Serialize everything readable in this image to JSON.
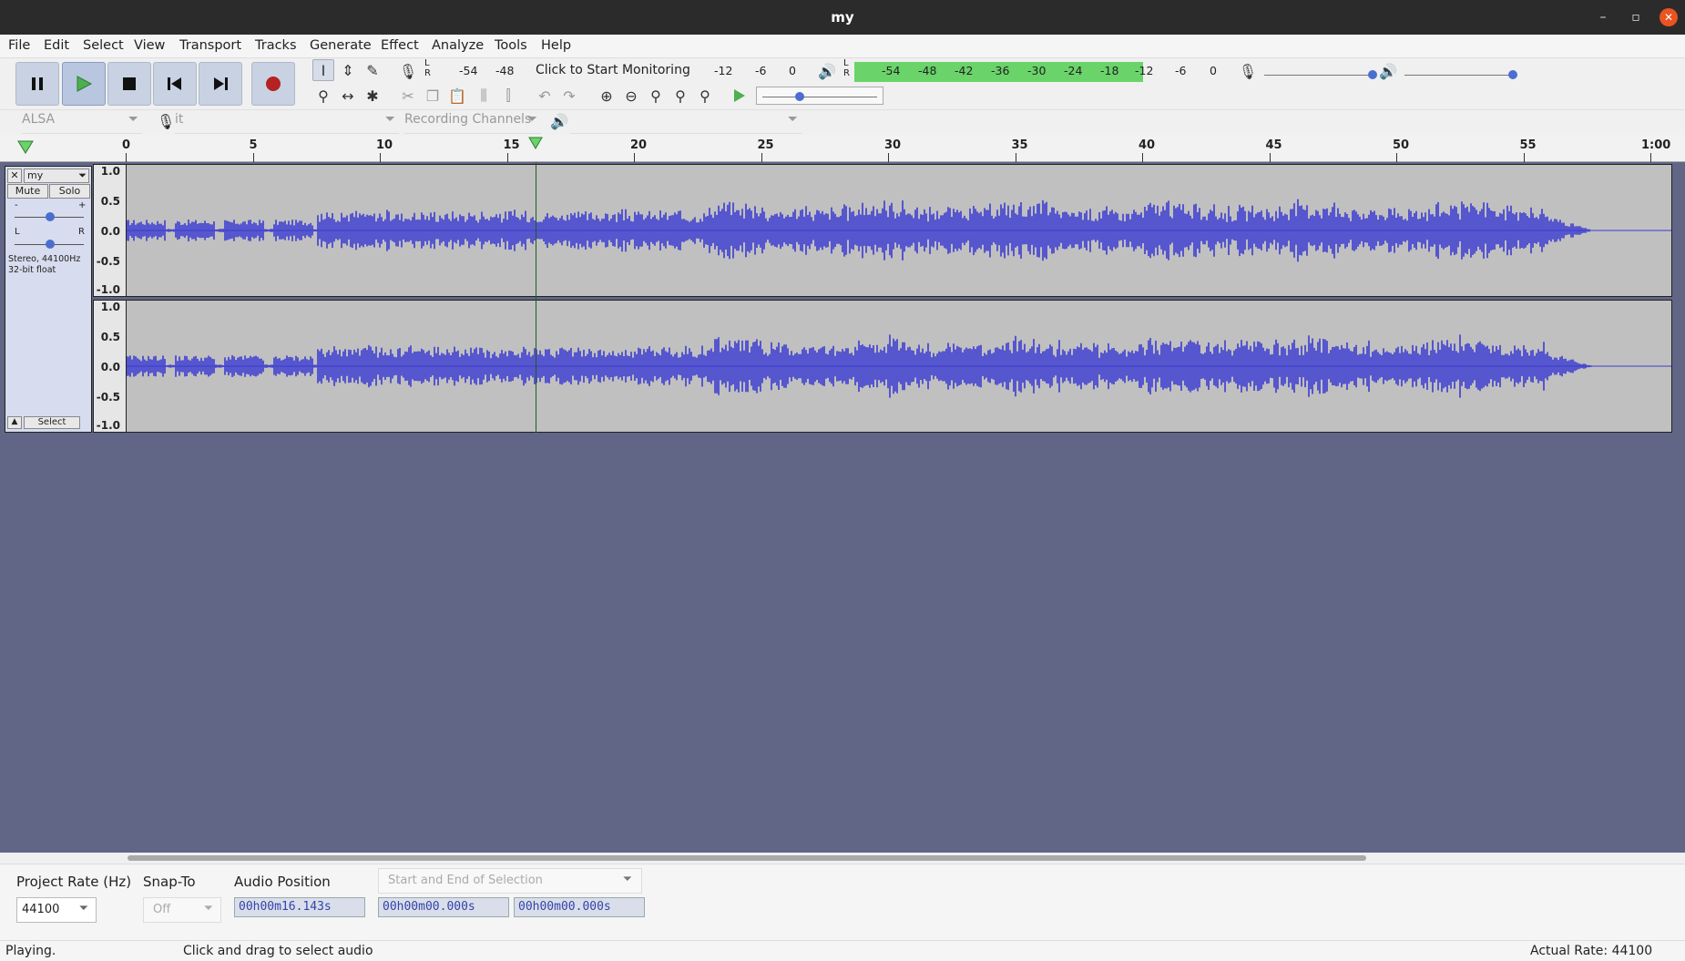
{
  "window": {
    "title": "my"
  },
  "menu": [
    "File",
    "Edit",
    "Select",
    "View",
    "Transport",
    "Tracks",
    "Generate",
    "Effect",
    "Analyze",
    "Tools",
    "Help"
  ],
  "recording_meter": {
    "scale": [
      "-54",
      "-48",
      "-12",
      "-6",
      "0"
    ],
    "prompt": "Click to Start Monitoring"
  },
  "playback_meter": {
    "scale": [
      "-54",
      "-48",
      "-42",
      "-36",
      "-30",
      "-24",
      "-18",
      "-12",
      "-6",
      "0"
    ],
    "level_db": -12
  },
  "device": {
    "host": "ALSA",
    "recording_device": "it",
    "channels": "Recording Channels"
  },
  "ruler": {
    "ticks": [
      "0",
      "5",
      "10",
      "15",
      "20",
      "25",
      "30",
      "35",
      "40",
      "45",
      "50",
      "55",
      "1:00"
    ],
    "playhead_seconds": 16.143
  },
  "track": {
    "name": "my",
    "mute": "Mute",
    "solo": "Solo",
    "gain_minus": "-",
    "gain_plus": "+",
    "pan_left": "L",
    "pan_right": "R",
    "info_line1": "Stereo, 44100Hz",
    "info_line2": "32-bit float",
    "select": "Select",
    "scale": [
      "1.0",
      "0.5",
      "0.0",
      "-0.5",
      "-1.0"
    ]
  },
  "bottom": {
    "project_rate_label": "Project Rate (Hz)",
    "project_rate_value": "44100",
    "snap_label": "Snap-To",
    "snap_value": "Off",
    "audio_position_label": "Audio Position",
    "audio_position": "00h00m16.143s",
    "selection_mode": "Start and End of Selection",
    "selection_start": "00h00m00.000s",
    "selection_end": "00h00m00.000s"
  },
  "status": {
    "left": "Playing.",
    "hint": "Click and drag to select audio",
    "rate": "Actual Rate: 44100"
  },
  "colors": {
    "waveform": "#3b3bd1",
    "meter_green": "#6ad36a",
    "workspace": "#616686"
  }
}
